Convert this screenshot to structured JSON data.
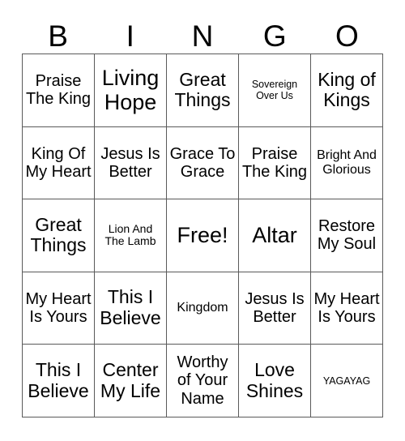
{
  "card": {
    "header_letters": [
      "B",
      "I",
      "N",
      "G",
      "O"
    ],
    "rows": [
      [
        {
          "text": "Praise The King",
          "size": "md"
        },
        {
          "text": "Living Hope",
          "size": "xl"
        },
        {
          "text": "Great Things",
          "size": "lg"
        },
        {
          "text": "Sovereign Over Us",
          "size": "xxs"
        },
        {
          "text": "King of Kings",
          "size": "lg"
        }
      ],
      [
        {
          "text": "King Of My Heart",
          "size": "md"
        },
        {
          "text": "Jesus Is Better",
          "size": "md"
        },
        {
          "text": "Grace To Grace",
          "size": "md"
        },
        {
          "text": "Praise The King",
          "size": "md"
        },
        {
          "text": "Bright And Glorious",
          "size": "sm"
        }
      ],
      [
        {
          "text": "Great Things",
          "size": "lg"
        },
        {
          "text": "Lion And The Lamb",
          "size": "xs"
        },
        {
          "text": "Free!",
          "size": "xl"
        },
        {
          "text": "Altar",
          "size": "xl"
        },
        {
          "text": "Restore My Soul",
          "size": "md"
        }
      ],
      [
        {
          "text": "My Heart Is Yours",
          "size": "md"
        },
        {
          "text": "This I Believe",
          "size": "lg"
        },
        {
          "text": "Kingdom",
          "size": "sm"
        },
        {
          "text": "Jesus Is Better",
          "size": "md"
        },
        {
          "text": "My Heart Is Yours",
          "size": "md"
        }
      ],
      [
        {
          "text": "This I Believe",
          "size": "lg"
        },
        {
          "text": "Center My Life",
          "size": "lg"
        },
        {
          "text": "Worthy of Your Name",
          "size": "md"
        },
        {
          "text": "Love Shines",
          "size": "lg"
        },
        {
          "text": "YAGAYAG",
          "size": "xxs"
        }
      ]
    ]
  },
  "colors": {
    "background": "#ffffff",
    "text": "#000000",
    "grid_line": "#5a5a5a"
  }
}
